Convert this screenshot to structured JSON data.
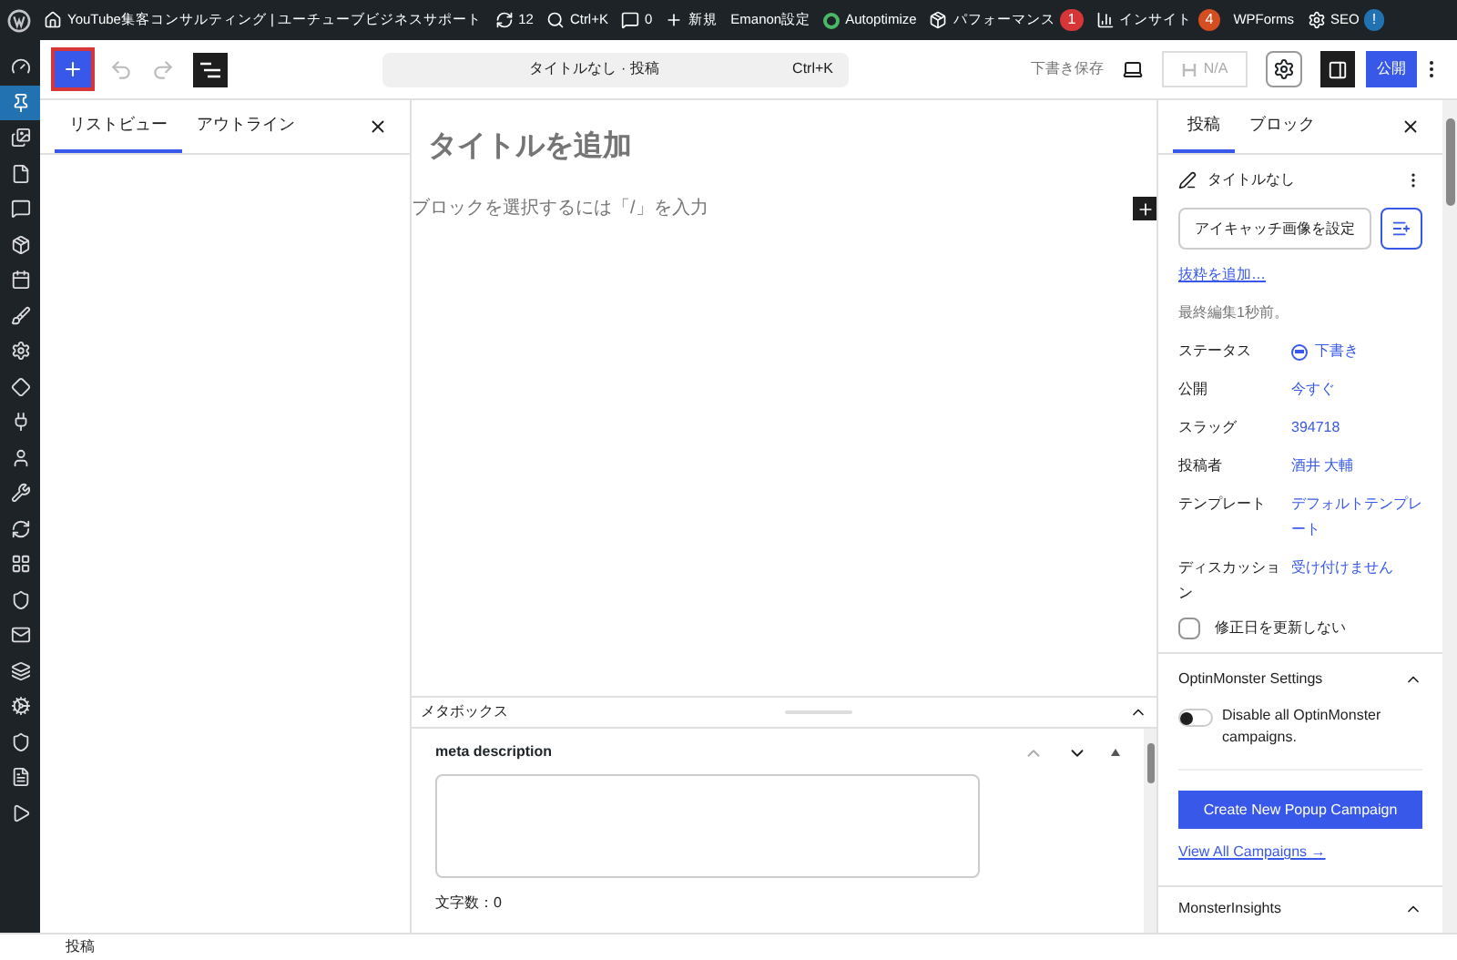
{
  "admin_bar": {
    "items": [
      {
        "kind": "site",
        "label": "YouTube集客コンサルティング | ユーチューブビジネスサポート"
      },
      {
        "kind": "updates",
        "label": "12"
      },
      {
        "kind": "search",
        "label": "Ctrl+K"
      },
      {
        "kind": "comments",
        "label": "0"
      },
      {
        "kind": "new",
        "label": "新規"
      },
      {
        "kind": "plain",
        "label": "Emanon設定"
      },
      {
        "kind": "status",
        "label": "Autoptimize"
      },
      {
        "kind": "performance",
        "label": "パフォーマンス",
        "badge": "1",
        "color": "#d63638"
      },
      {
        "kind": "insights",
        "label": "インサイト",
        "badge": "4",
        "color": "#d54e21"
      },
      {
        "kind": "plain",
        "label": "WPForms"
      },
      {
        "kind": "seo",
        "label": "SEO",
        "badge": "!",
        "color": "#2271b1"
      }
    ]
  },
  "admin_menu": [
    {
      "selected": false
    },
    {
      "selected": true
    },
    {
      "selected": false
    },
    {
      "selected": false
    },
    {
      "selected": false
    },
    {
      "selected": false
    },
    {
      "selected": false
    },
    {
      "selected": false
    },
    {
      "selected": false
    },
    {
      "selected": false
    },
    {
      "selected": false
    },
    {
      "selected": false
    },
    {
      "selected": false
    },
    {
      "selected": false
    },
    {
      "selected": false
    },
    {
      "selected": false
    },
    {
      "selected": false
    },
    {
      "selected": false
    },
    {
      "selected": false
    },
    {
      "selected": false
    },
    {
      "selected": false
    },
    {
      "selected": false
    }
  ],
  "toolbar": {
    "inserter_open": false,
    "list_view_open": true,
    "command_bar": {
      "title": "タイトルなし · 投稿",
      "shortcut": "Ctrl+K"
    },
    "save_draft": "下書き保存",
    "seo_score": "N/A",
    "settings_open": true,
    "publish": "公開"
  },
  "list_panel": {
    "tabs": [
      {
        "label": "リストビュー",
        "selected": true
      },
      {
        "label": "アウトライン",
        "selected": false
      }
    ]
  },
  "canvas": {
    "title_placeholder": "タイトルを追加",
    "block_placeholder": "ブロックを選択するには「/」を入力"
  },
  "metabox": {
    "title": "メタボックス",
    "expanded": true,
    "field": {
      "label": "meta description",
      "counter": "文字数：0"
    }
  },
  "settings": {
    "tabs": [
      {
        "label": "投稿",
        "selected": true
      },
      {
        "label": "ブロック",
        "selected": false
      }
    ],
    "post_title": "タイトルなし",
    "featured_image": "アイキャッチ画像を設定",
    "excerpt_link": "抜粋を追加…",
    "last_edited": "最終編集1秒前。",
    "rows": [
      {
        "label": "ステータス",
        "value": "下書き",
        "kind": "status"
      },
      {
        "label": "公開",
        "value": "今すぐ",
        "kind": "link"
      },
      {
        "label": "スラッグ",
        "value": "394718",
        "kind": "link"
      },
      {
        "label": "投稿者",
        "value": "酒井 大輔",
        "kind": "link"
      },
      {
        "label": "テンプレート",
        "value": "デフォルトテンプレート",
        "kind": "link"
      },
      {
        "label": "ディスカッション",
        "value": "受け付けません",
        "kind": "link"
      }
    ],
    "keep_date": {
      "label": "修正日を更新しない",
      "checked": false
    },
    "optin": {
      "title": "OptinMonster Settings",
      "expanded": true,
      "toggle": {
        "label": "Disable all OptinMonster campaigns.",
        "on": false
      },
      "button": "Create New Popup Campaign",
      "link": "View All Campaigns →"
    },
    "insights": {
      "title": "MonsterInsights",
      "expanded": true
    }
  },
  "status_bar": {
    "label": "投稿"
  }
}
